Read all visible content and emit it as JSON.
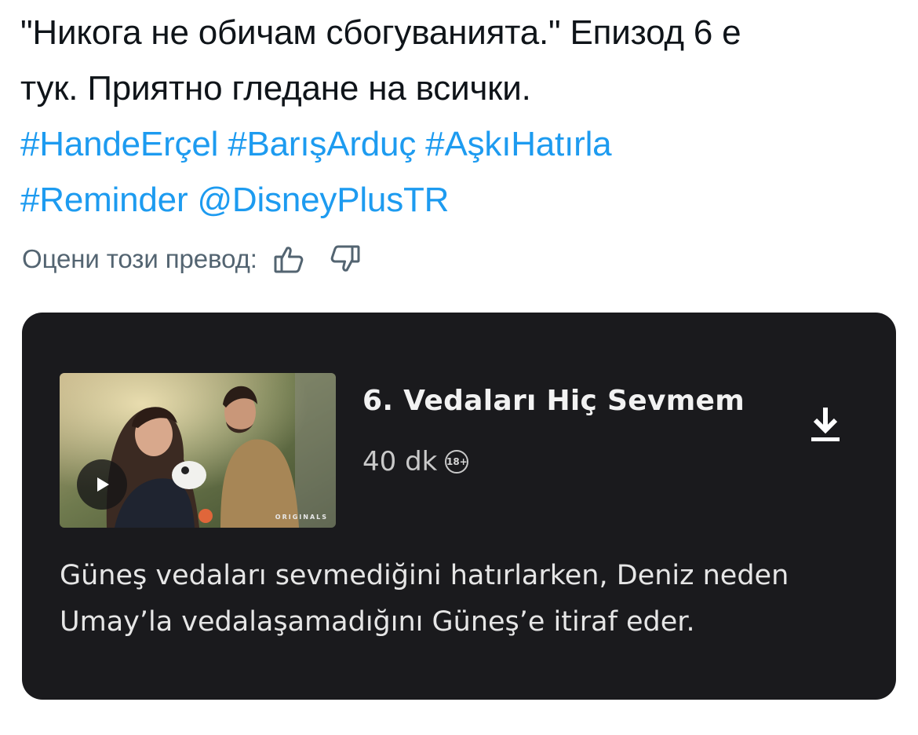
{
  "tweet": {
    "lines": [
      [
        {
          "type": "text",
          "value": "\"Никога не обичам сбогуванията.\" Епизод 6 е"
        }
      ],
      [
        {
          "type": "text",
          "value": "тук. Приятно гледане на всички."
        }
      ],
      [
        {
          "type": "hashtag",
          "value": "#HandeErçel"
        },
        {
          "type": "text",
          "value": " "
        },
        {
          "type": "hashtag",
          "value": "#BarışArduç"
        },
        {
          "type": "text",
          "value": " "
        },
        {
          "type": "hashtag",
          "value": "#AşkıHatırla"
        }
      ],
      [
        {
          "type": "hashtag",
          "value": "#Reminder"
        },
        {
          "type": "text",
          "value": " "
        },
        {
          "type": "mention",
          "value": "@DisneyPlusTR"
        }
      ]
    ],
    "rate_translation_label": "Оцени този превод:",
    "rate_up_icon": "thumbs-up-icon",
    "rate_down_icon": "thumbs-down-icon"
  },
  "episode_card": {
    "title": "6. Vedaları Hiç Sevmem",
    "duration": "40 dk",
    "age_rating": "18+",
    "badge_text": "ORIGINALS",
    "play_icon": "play-icon",
    "download_icon": "download-icon",
    "description_lines": [
      "Güneş vedaları sevmediğini hatırlarken, Deniz neden",
      "Umay’la vedalaşamadığını Güneş’e itiraf eder."
    ]
  },
  "colors": {
    "link": "#1d9bf0",
    "text": "#0f1419",
    "muted": "#536471",
    "card_bg": "#1a1a1d"
  }
}
